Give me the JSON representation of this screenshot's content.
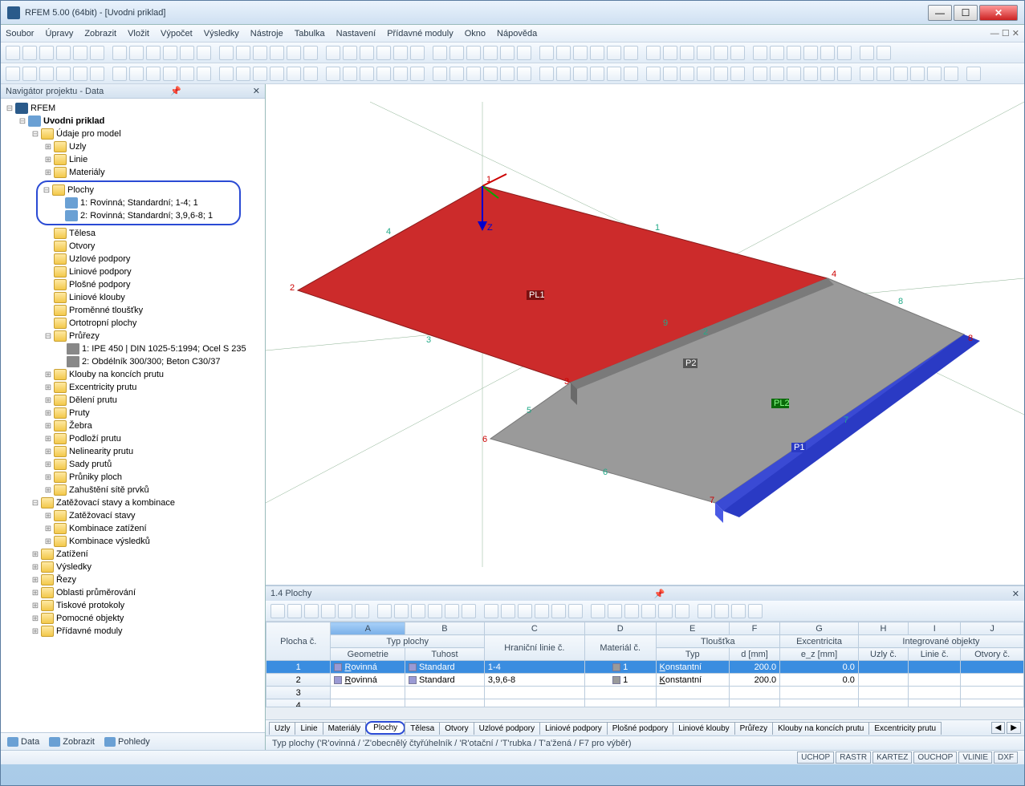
{
  "window": {
    "title": "RFEM 5.00 (64bit) - [Uvodni priklad]"
  },
  "menubar": [
    "Soubor",
    "Úpravy",
    "Zobrazit",
    "Vložit",
    "Výpočet",
    "Výsledky",
    "Nástroje",
    "Tabulka",
    "Nastavení",
    "Přídavné moduly",
    "Okno",
    "Nápověda"
  ],
  "navigator": {
    "title": "Navigátor projektu - Data",
    "root": "RFEM",
    "project": "Uvodni priklad",
    "udaje": "Údaje pro model",
    "items_pre": [
      "Uzly",
      "Linie",
      "Materiály"
    ],
    "plochy": {
      "label": "Plochy",
      "children": [
        "1: Rovinná; Standardní; 1-4; 1",
        "2: Rovinná; Standardní; 3,9,6-8; 1"
      ]
    },
    "items_mid": [
      "Tělesa",
      "Otvory",
      "Uzlové podpory",
      "Liniové podpory",
      "Plošné podpory",
      "Liniové klouby",
      "Proměnné tloušťky",
      "Ortotropní plochy"
    ],
    "prurezy": {
      "label": "Průřezy",
      "children": [
        "1: IPE 450 | DIN 1025-5:1994; Ocel S 235",
        "2: Obdélník 300/300; Beton C30/37"
      ]
    },
    "items_post": [
      "Klouby na koncích prutu",
      "Excentricity prutu",
      "Dělení prutu",
      "Pruty",
      "Žebra",
      "Podloží prutu",
      "Nelinearity prutu",
      "Sady prutů",
      "Průniky ploch",
      "Zahuštění sítě prvků"
    ],
    "zatez": {
      "label": "Zatěžovací stavy a kombinace",
      "children": [
        "Zatěžovací stavy",
        "Kombinace zatížení",
        "Kombinace výsledků"
      ]
    },
    "items_end": [
      "Zatížení",
      "Výsledky",
      "Řezy",
      "Oblasti průměrování",
      "Tiskové protokoly",
      "Pomocné objekty",
      "Přídavné moduly"
    ],
    "tabs": [
      "Data",
      "Zobrazit",
      "Pohledy"
    ]
  },
  "viewport": {
    "labels": {
      "pl1": "PL1",
      "pl2": "PL2",
      "p1": "P1",
      "p2": "P2",
      "z": "Z"
    },
    "nodes": [
      "1",
      "2",
      "3",
      "4",
      "5",
      "6",
      "7",
      "8",
      "9"
    ]
  },
  "table_panel": {
    "title": "1.4 Plochy",
    "cols": [
      "A",
      "B",
      "C",
      "D",
      "E",
      "F",
      "G",
      "H",
      "I",
      "J"
    ],
    "hdr_rowlabel": "Plocha č.",
    "hdr_groups": {
      "typ": "Typ plochy",
      "mat": "Materiál č.",
      "tl": "Tloušťka",
      "exc": "Excentricita",
      "int": "Integrované objekty"
    },
    "hdr_sub": [
      "Geometrie",
      "Tuhost",
      "Hraniční linie č.",
      "",
      "Typ",
      "d [mm]",
      "e_z [mm]",
      "Uzly č.",
      "Linie č.",
      "Otvory č."
    ],
    "rows": [
      {
        "n": "1",
        "geom": "Rovinná",
        "tuh": "Standard",
        "lin": "1-4",
        "mat": "1",
        "typ": "Konstantní",
        "d": "200.0",
        "ez": "0.0"
      },
      {
        "n": "2",
        "geom": "Rovinná",
        "tuh": "Standard",
        "lin": "3,9,6-8",
        "mat": "1",
        "typ": "Konstantní",
        "d": "200.0",
        "ez": "0.0"
      },
      {
        "n": "3"
      },
      {
        "n": "4"
      }
    ],
    "tabs": [
      "Uzly",
      "Linie",
      "Materiály",
      "Plochy",
      "Tělesa",
      "Otvory",
      "Uzlové podpory",
      "Liniové podpory",
      "Plošné podpory",
      "Liniové klouby",
      "Průřezy",
      "Klouby na koncích prutu",
      "Excentricity prutu"
    ],
    "active_tab": 3,
    "status": "Typ plochy ('R'ovinná / 'Z'obecnělý čtyřúhelník / 'R'otační / 'T'rubka / T'a'žená / F7 pro výběr)"
  },
  "statusbar": {
    "buttons": [
      "UCHOP",
      "RASTR",
      "KARTEZ",
      "OUCHOP",
      "VLINIE",
      "DXF"
    ]
  }
}
